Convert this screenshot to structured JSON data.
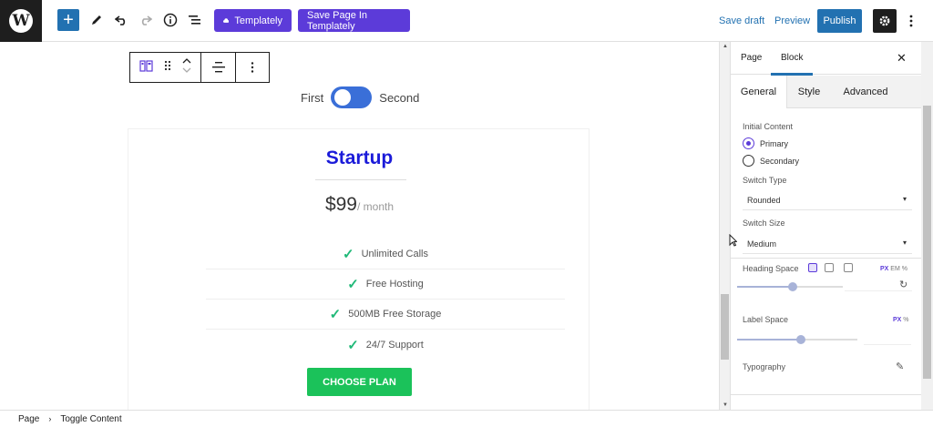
{
  "topbar": {
    "logo_letter": "W",
    "add_symbol": "+",
    "templately_label": "Templately",
    "save_templately_label": "Save Page In Templately",
    "save_draft_label": "Save draft",
    "preview_label": "Preview",
    "publish_label": "Publish",
    "icons": [
      "wordpress-logo-icon",
      "plus-icon",
      "pencil-icon",
      "undo-icon",
      "redo-icon",
      "info-icon",
      "list-view-icon",
      "cloud-icon",
      "gear-icon",
      "more-vertical-icon"
    ],
    "accent_color": "#2271b1",
    "templately_color": "#5c3bd9"
  },
  "canvas": {
    "toggle": {
      "first_label": "First",
      "second_label": "Second",
      "state": "first"
    },
    "card": {
      "title": "Startup",
      "price": "$99",
      "period": "/ month",
      "features": [
        "Unlimited Calls",
        "Free Hosting",
        "500MB Free Storage",
        "24/7 Support"
      ],
      "button_label": "CHOOSE PLAN",
      "title_color": "#1b1bd9",
      "button_color": "#1bc25a",
      "check_color": "#20b978"
    }
  },
  "sidebar": {
    "tabs": [
      "Page",
      "Block"
    ],
    "active_tab": "Block",
    "sub_tabs": [
      "General",
      "Style",
      "Advanced"
    ],
    "active_sub_tab": "General",
    "initial_content_label": "Initial Content",
    "radio_options": [
      "Primary",
      "Secondary"
    ],
    "selected_radio": "Primary",
    "switch_type_label": "Switch Type",
    "switch_type_value": "Rounded",
    "switch_size_label": "Switch Size",
    "switch_size_value": "Medium",
    "heading_space_label": "Heading Space",
    "heading_space_units": [
      "PX",
      "EM",
      "%"
    ],
    "heading_space_fraction": 0.52,
    "label_space_label": "Label Space",
    "label_space_units": [
      "PX",
      "%"
    ],
    "label_space_fraction": 0.53,
    "typography_label": "Typography"
  },
  "footer": {
    "breadcrumb": [
      "Page",
      "Toggle Content"
    ]
  }
}
